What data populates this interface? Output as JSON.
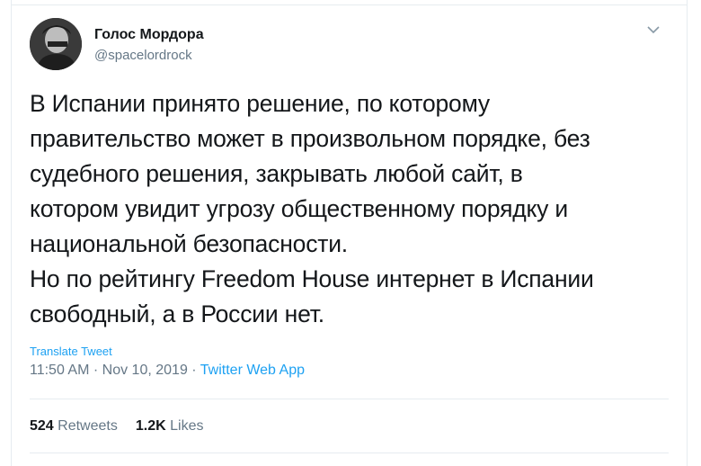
{
  "author": {
    "display_name": "Голос Мордора",
    "handle": "@spacelordrock"
  },
  "tweet": {
    "text": "В Испании принято решение, по которому\nправительство может в произвольном порядке, без\nсудебного решения, закрывать любой сайт, в\nкотором увидит угрозу общественному порядку и\nнациональной безопасности.\nНо по рейтингу Freedom House интернет в Испании\nсвободный, а в России нет.",
    "translate_label": "Translate Tweet",
    "time": "11:50 AM",
    "date": "Nov 10, 2019",
    "separator": "·",
    "source": "Twitter Web App"
  },
  "stats": {
    "retweets_count": "524",
    "retweets_label": "Retweets",
    "likes_count": "1.2K",
    "likes_label": "Likes"
  },
  "icons": {
    "caret": "chevron-down-icon"
  },
  "colors": {
    "accent": "#1da1f2",
    "secondary_text": "#657786",
    "primary_text": "#14171a",
    "divider": "#e6ecf0"
  }
}
